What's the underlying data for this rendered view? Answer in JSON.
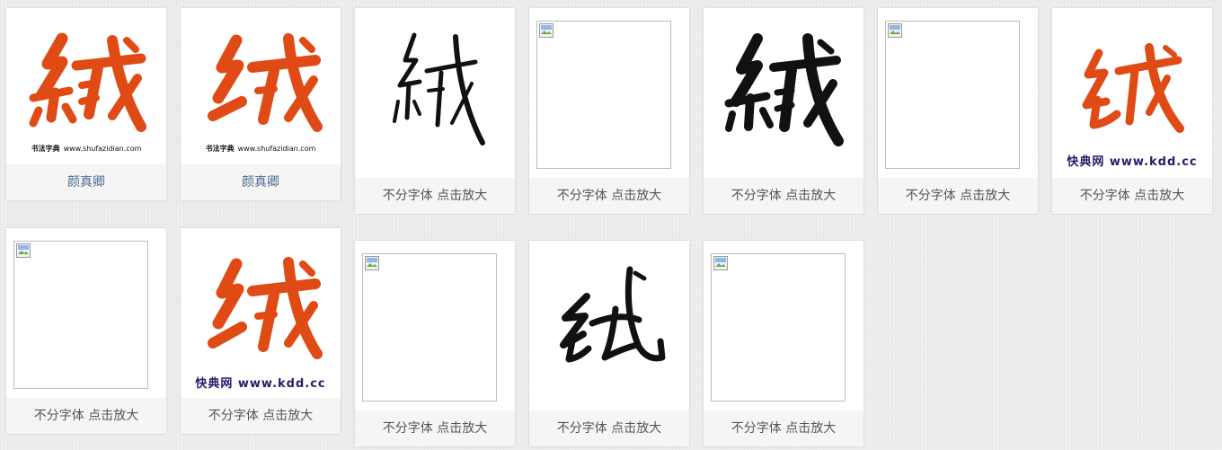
{
  "accent_colors": {
    "calligraphy_red": "#e04a14",
    "calligraphy_black": "#111111",
    "link_blue": "#4a6a8f",
    "kdd_purple": "#2a1a6b"
  },
  "watermarks": {
    "shufa": {
      "brand": "书法字典",
      "url": "www.shufazidian.com"
    },
    "kdd": {
      "text": "快典网 www.kdd.cc"
    }
  },
  "cards": [
    {
      "caption": "颜真卿"
    },
    {
      "caption": "颜真卿"
    },
    {
      "caption": "不分字体 点击放大"
    },
    {
      "caption": "不分字体 点击放大"
    },
    {
      "caption": "不分字体 点击放大"
    },
    {
      "caption": "不分字体 点击放大"
    },
    {
      "caption": "不分字体 点击放大"
    },
    {
      "caption": "不分字体 点击放大"
    },
    {
      "caption": "不分字体 点击放大"
    },
    {
      "caption": "不分字体 点击放大"
    },
    {
      "caption": "不分字体 点击放大"
    },
    {
      "caption": "不分字体 点击放大"
    }
  ],
  "broken_image_icon": "broken-image-icon"
}
